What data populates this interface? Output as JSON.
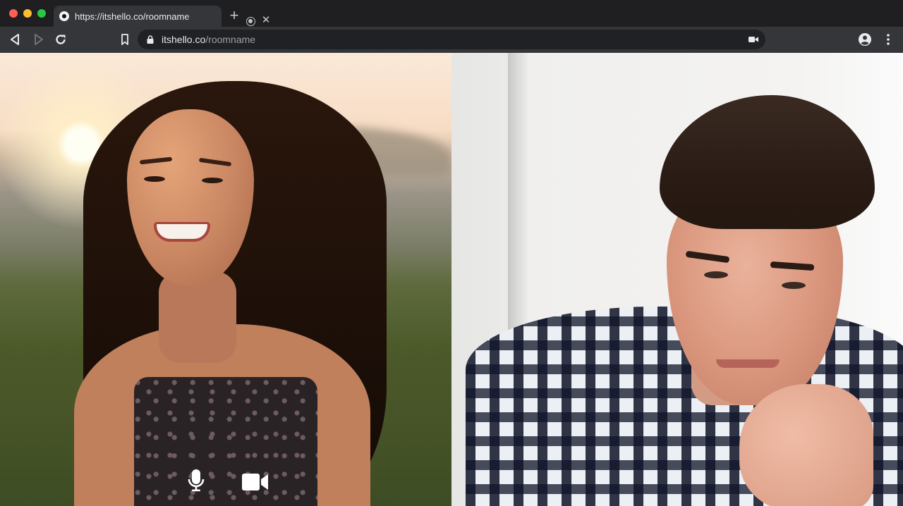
{
  "window": {
    "traffic_lights": [
      "close",
      "minimize",
      "zoom"
    ],
    "colors": {
      "red": "#fe5f57",
      "yellow": "#febc2e",
      "green": "#28c840"
    }
  },
  "tab": {
    "title": "https://itshello.co/roomname",
    "favicon": "itshello-icon",
    "recording_indicator": "recording-icon",
    "close_icon": "close-icon"
  },
  "new_tab_icon": "plus-icon",
  "toolbar": {
    "back_icon": "back-arrow-icon",
    "forward_icon": "forward-arrow-icon",
    "reload_icon": "reload-icon",
    "bookmark_icon": "bookmark-icon",
    "profile_icon": "account-circle-icon",
    "menu_icon": "kebab-menu-icon"
  },
  "omnibox": {
    "lock_icon": "lock-icon",
    "url_host": "itshello.co",
    "url_path": "/roomname",
    "camera_indicator": "camera-in-use-icon"
  },
  "call": {
    "participants": [
      "participant-left",
      "participant-right"
    ],
    "controls": {
      "mic_icon": "microphone-icon",
      "camera_icon": "video-camera-icon"
    }
  }
}
